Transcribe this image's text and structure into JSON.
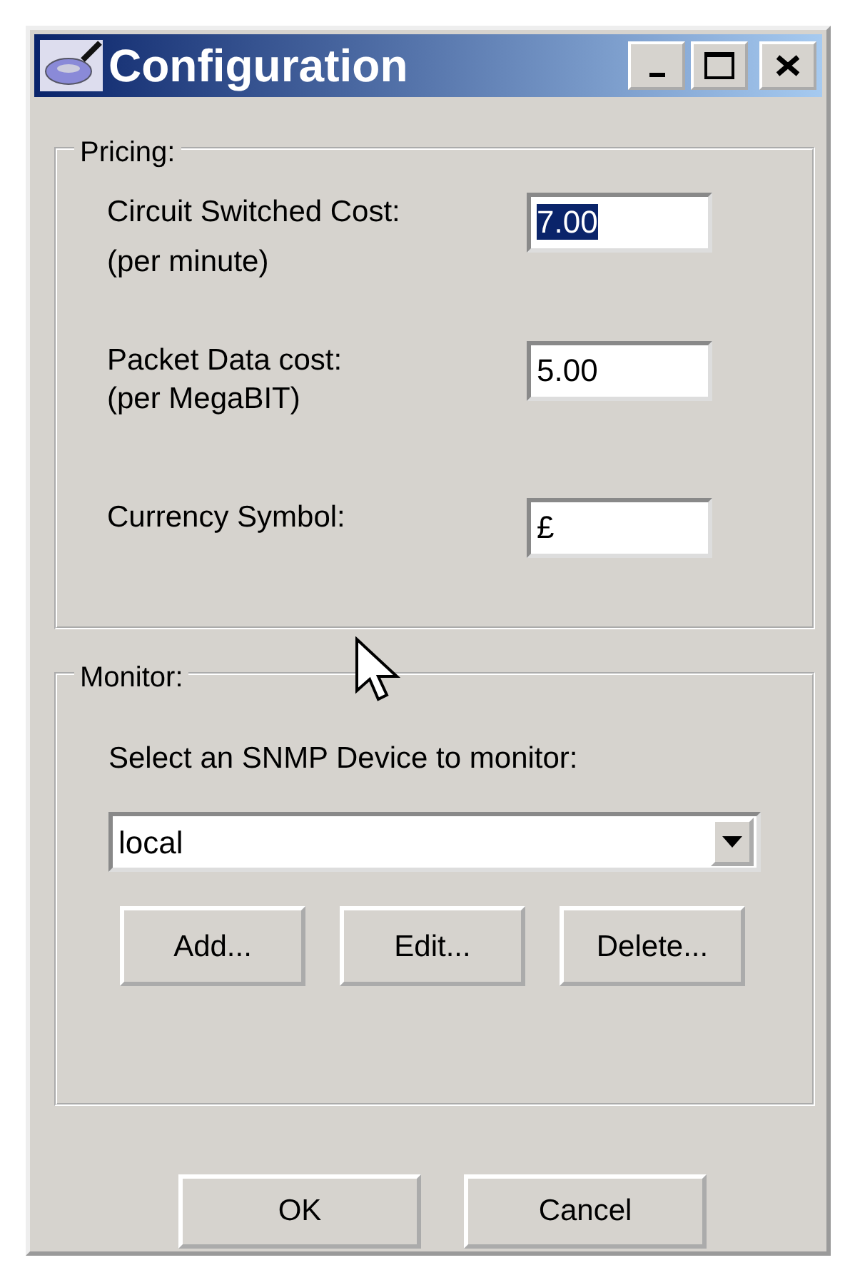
{
  "window": {
    "title": "Configuration"
  },
  "pricing": {
    "legend": "Pricing:",
    "fields": [
      {
        "label": "Circuit Switched Cost:",
        "sublabel": "(per minute)",
        "value": "7.00",
        "selected": true
      },
      {
        "label": "Packet Data cost:",
        "sublabel": "(per MegaBIT)",
        "value": "5.00",
        "selected": false
      },
      {
        "label": "Currency Symbol:",
        "value": "£",
        "selected": false
      }
    ]
  },
  "monitor": {
    "legend": "Monitor:",
    "prompt": "Select an SNMP Device to monitor:",
    "device": "local",
    "buttons": [
      "Add...",
      "Edit...",
      "Delete..."
    ]
  },
  "buttons": [
    "OK",
    "Cancel"
  ]
}
